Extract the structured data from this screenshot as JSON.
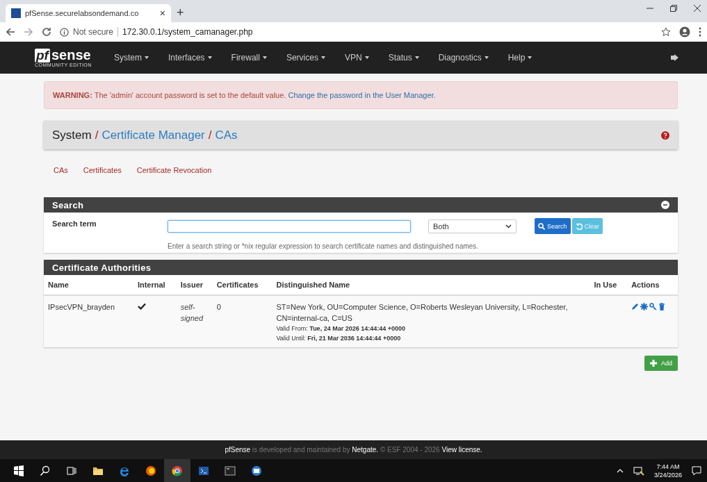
{
  "browser": {
    "tab_title": "pfSense.securelabsondemand.co",
    "tab_close": "×",
    "new_tab": "+",
    "security": "Not secure",
    "url": "172.30.0.1/system_camanager.php"
  },
  "navbar": {
    "logo_mark": "pf",
    "logo_word": "sense",
    "logo_sub": "COMMUNITY EDITION",
    "menu": [
      "System",
      "Interfaces",
      "Firewall",
      "Services",
      "VPN",
      "Status",
      "Diagnostics",
      "Help"
    ]
  },
  "warning": {
    "text": "**WARNING:** The 'admin' account password is set to the default value.",
    "link": "Change the password in the User Manager."
  },
  "breadcrumb": {
    "separator": "/",
    "items": [
      {
        "label": "System",
        "link": false
      },
      {
        "label": "Certificate Manager",
        "link": true
      },
      {
        "label": "CAs",
        "link": true
      }
    ]
  },
  "tabs": [
    "CAs",
    "Certificates",
    "Certificate Revocation"
  ],
  "search": {
    "title": "Search",
    "term_label": "Search term",
    "scope": "Both",
    "search_button": "Search",
    "clear_button": "Clear",
    "help": "Enter a search string or *nix regular expression to search certificate names and distinguished names."
  },
  "authorities": {
    "title": "Certificate Authorities",
    "columns": [
      "Name",
      "Internal",
      "Issuer",
      "Certificates",
      "Distinguished Name",
      "In Use",
      "Actions"
    ],
    "rows": [
      {
        "name": "IPsecVPN_brayden",
        "internal": true,
        "issuer": "self-signed",
        "certificates": "0",
        "dn": "ST=New York, OU=Computer Science, O=Roberts Wesleyan University, L=Rochester, CN=internal-ca, C=US",
        "valid_from": "Valid From: **Tue, 24 Mar 2026 14:44:44 +0000**",
        "valid_until": "Valid Until: **Fri, 21 Mar 2036 14:44:44 +0000**"
      }
    ]
  },
  "add_button": "Add",
  "footer": "**pfSense** is developed and maintained by **Netgate.** © ESF 2004 - 2026 **View license.**",
  "taskbar": {
    "time": "7:44 AM",
    "date": "3/24/2026"
  }
}
